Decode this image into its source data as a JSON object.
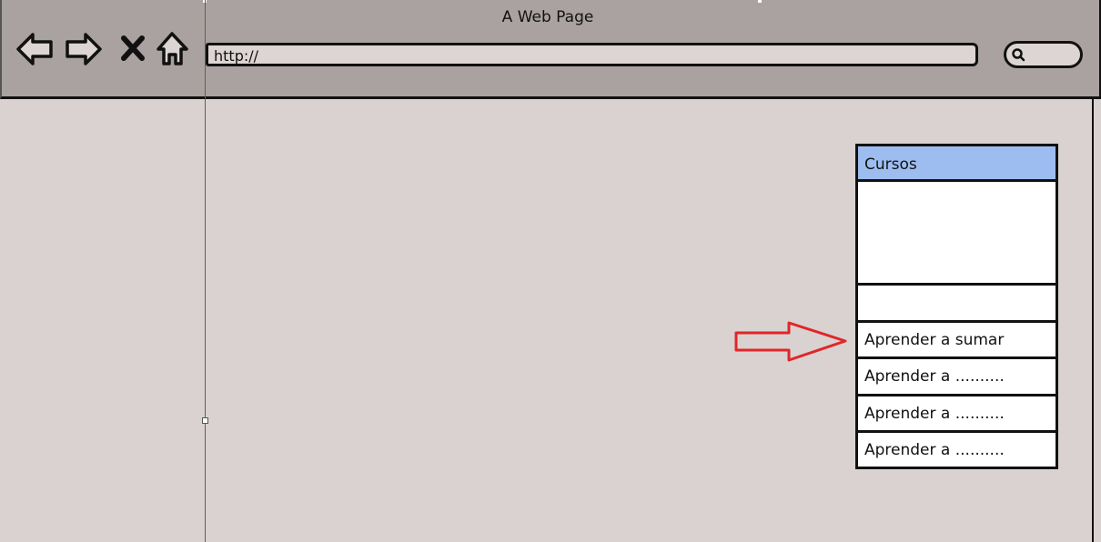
{
  "window": {
    "title": "A Web Page"
  },
  "toolbar": {
    "back_icon": "back-arrow-icon",
    "forward_icon": "forward-arrow-icon",
    "stop_icon": "close-icon",
    "home_icon": "home-icon",
    "address": "http://",
    "search_icon": "search-icon"
  },
  "course_panel": {
    "title": "Cursos",
    "items": [
      "",
      "Aprender a sumar",
      "Aprender a ..........",
      "Aprender a ..........",
      "Aprender a .........."
    ]
  },
  "annotation": {
    "arrow_icon": "right-arrow-icon",
    "arrow_color": "#e0262a"
  },
  "colors": {
    "toolbar_bg": "#aaa2a0",
    "page_bg": "#d9d2d0",
    "header_accent": "#9dbdf0"
  }
}
